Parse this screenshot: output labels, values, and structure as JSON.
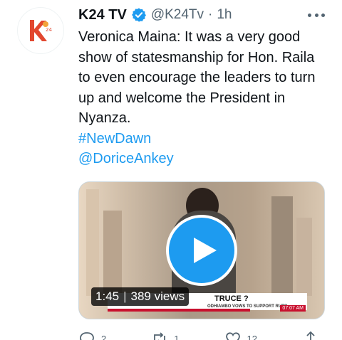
{
  "author": {
    "name": "K24 TV",
    "handle": "@K24Tv",
    "separator": "·",
    "time": "1h",
    "avatar_icon": "k24-logo-icon",
    "verified_icon": "verified-badge-icon"
  },
  "tweet": {
    "text": "Veronica Maina: It was a very good show of statesmanship for Hon. Raila to even encourage the leaders to turn up and welcome the President in Nyanza.",
    "hashtag": "#NewDawn",
    "mention": "@DoriceAnkey"
  },
  "media": {
    "duration": "1:45",
    "separator": "|",
    "views": "389 views",
    "ticker_title": "TRUCE ?",
    "ticker_subtitle": "ODHIAMBO VOWS TO SUPPORT RUTO",
    "ticker_time": "07:07 AM",
    "play_icon": "play-icon"
  },
  "actions": {
    "reply_count": "2",
    "retweet_count": "1",
    "like_count": "12"
  },
  "colors": {
    "accent": "#1d9bf0",
    "secondary_text": "#536471",
    "primary_text": "#0f1419"
  }
}
